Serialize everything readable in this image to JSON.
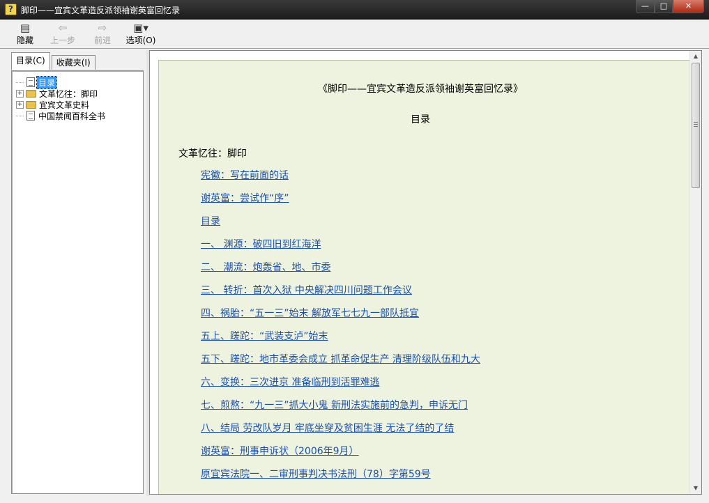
{
  "window": {
    "title": "脚印——宜宾文革造反派领袖谢英富回忆录",
    "app_icon": "help-book-icon",
    "buttons": {
      "minimize": "—",
      "maximize": "□",
      "close": "✕"
    }
  },
  "toolbar": {
    "hide_label": "隐藏",
    "back_label": "上一步",
    "forward_label": "前进",
    "options_label": "选项(O)"
  },
  "left_pane": {
    "tabs": [
      {
        "label": "目录(C)",
        "active": true
      },
      {
        "label": "收藏夹(I)",
        "active": false
      }
    ],
    "tree": [
      {
        "label": "目录",
        "type": "page",
        "expander": "none",
        "selected": true
      },
      {
        "label": "文革忆往：脚印",
        "type": "folder",
        "expander": "+",
        "selected": false
      },
      {
        "label": "宜宾文革史料",
        "type": "folder",
        "expander": "+",
        "selected": false
      },
      {
        "label": "中国禁闻百科全书",
        "type": "page",
        "expander": "none",
        "selected": false
      }
    ]
  },
  "content": {
    "doc_title": "《脚印——宜宾文革造反派领袖谢英富回忆录》",
    "doc_subtitle": "目录",
    "section_heading": "文革忆往：脚印",
    "links": [
      "宪徽：写在前面的话",
      "谢英富：尝试作“序”",
      "目录",
      "一、 渊源：破四旧到红海洋",
      "二、 潮流：炮轰省、地、市委",
      "三、 转折：首次入狱 中央解决四川问题工作会议",
      "四、祸胎：“五一三”始末 解放军七七九一部队抵宜",
      "五上、蹉跎：“武装支泸”始末",
      "五下、蹉跎：地市革委会成立 抓革命促生产 清理阶级队伍和九大",
      "六、变换：三次进京 准备临刑到活罪难逃",
      "七、煎熬：“九一三”抓大小鬼 新刑法实施前的急判，申诉无门",
      "八、结局 劳改队岁月 牢底坐穿及贫困生涯 无法了结的了结",
      "谢英富：刑事申诉状（2006年9月）",
      "原宜宾法院一、二审刑事判决书法刑（78）字第59号"
    ]
  },
  "colors": {
    "page_background": "#eef3df",
    "link": "#1a4fa8",
    "selection": "#3399ff"
  }
}
